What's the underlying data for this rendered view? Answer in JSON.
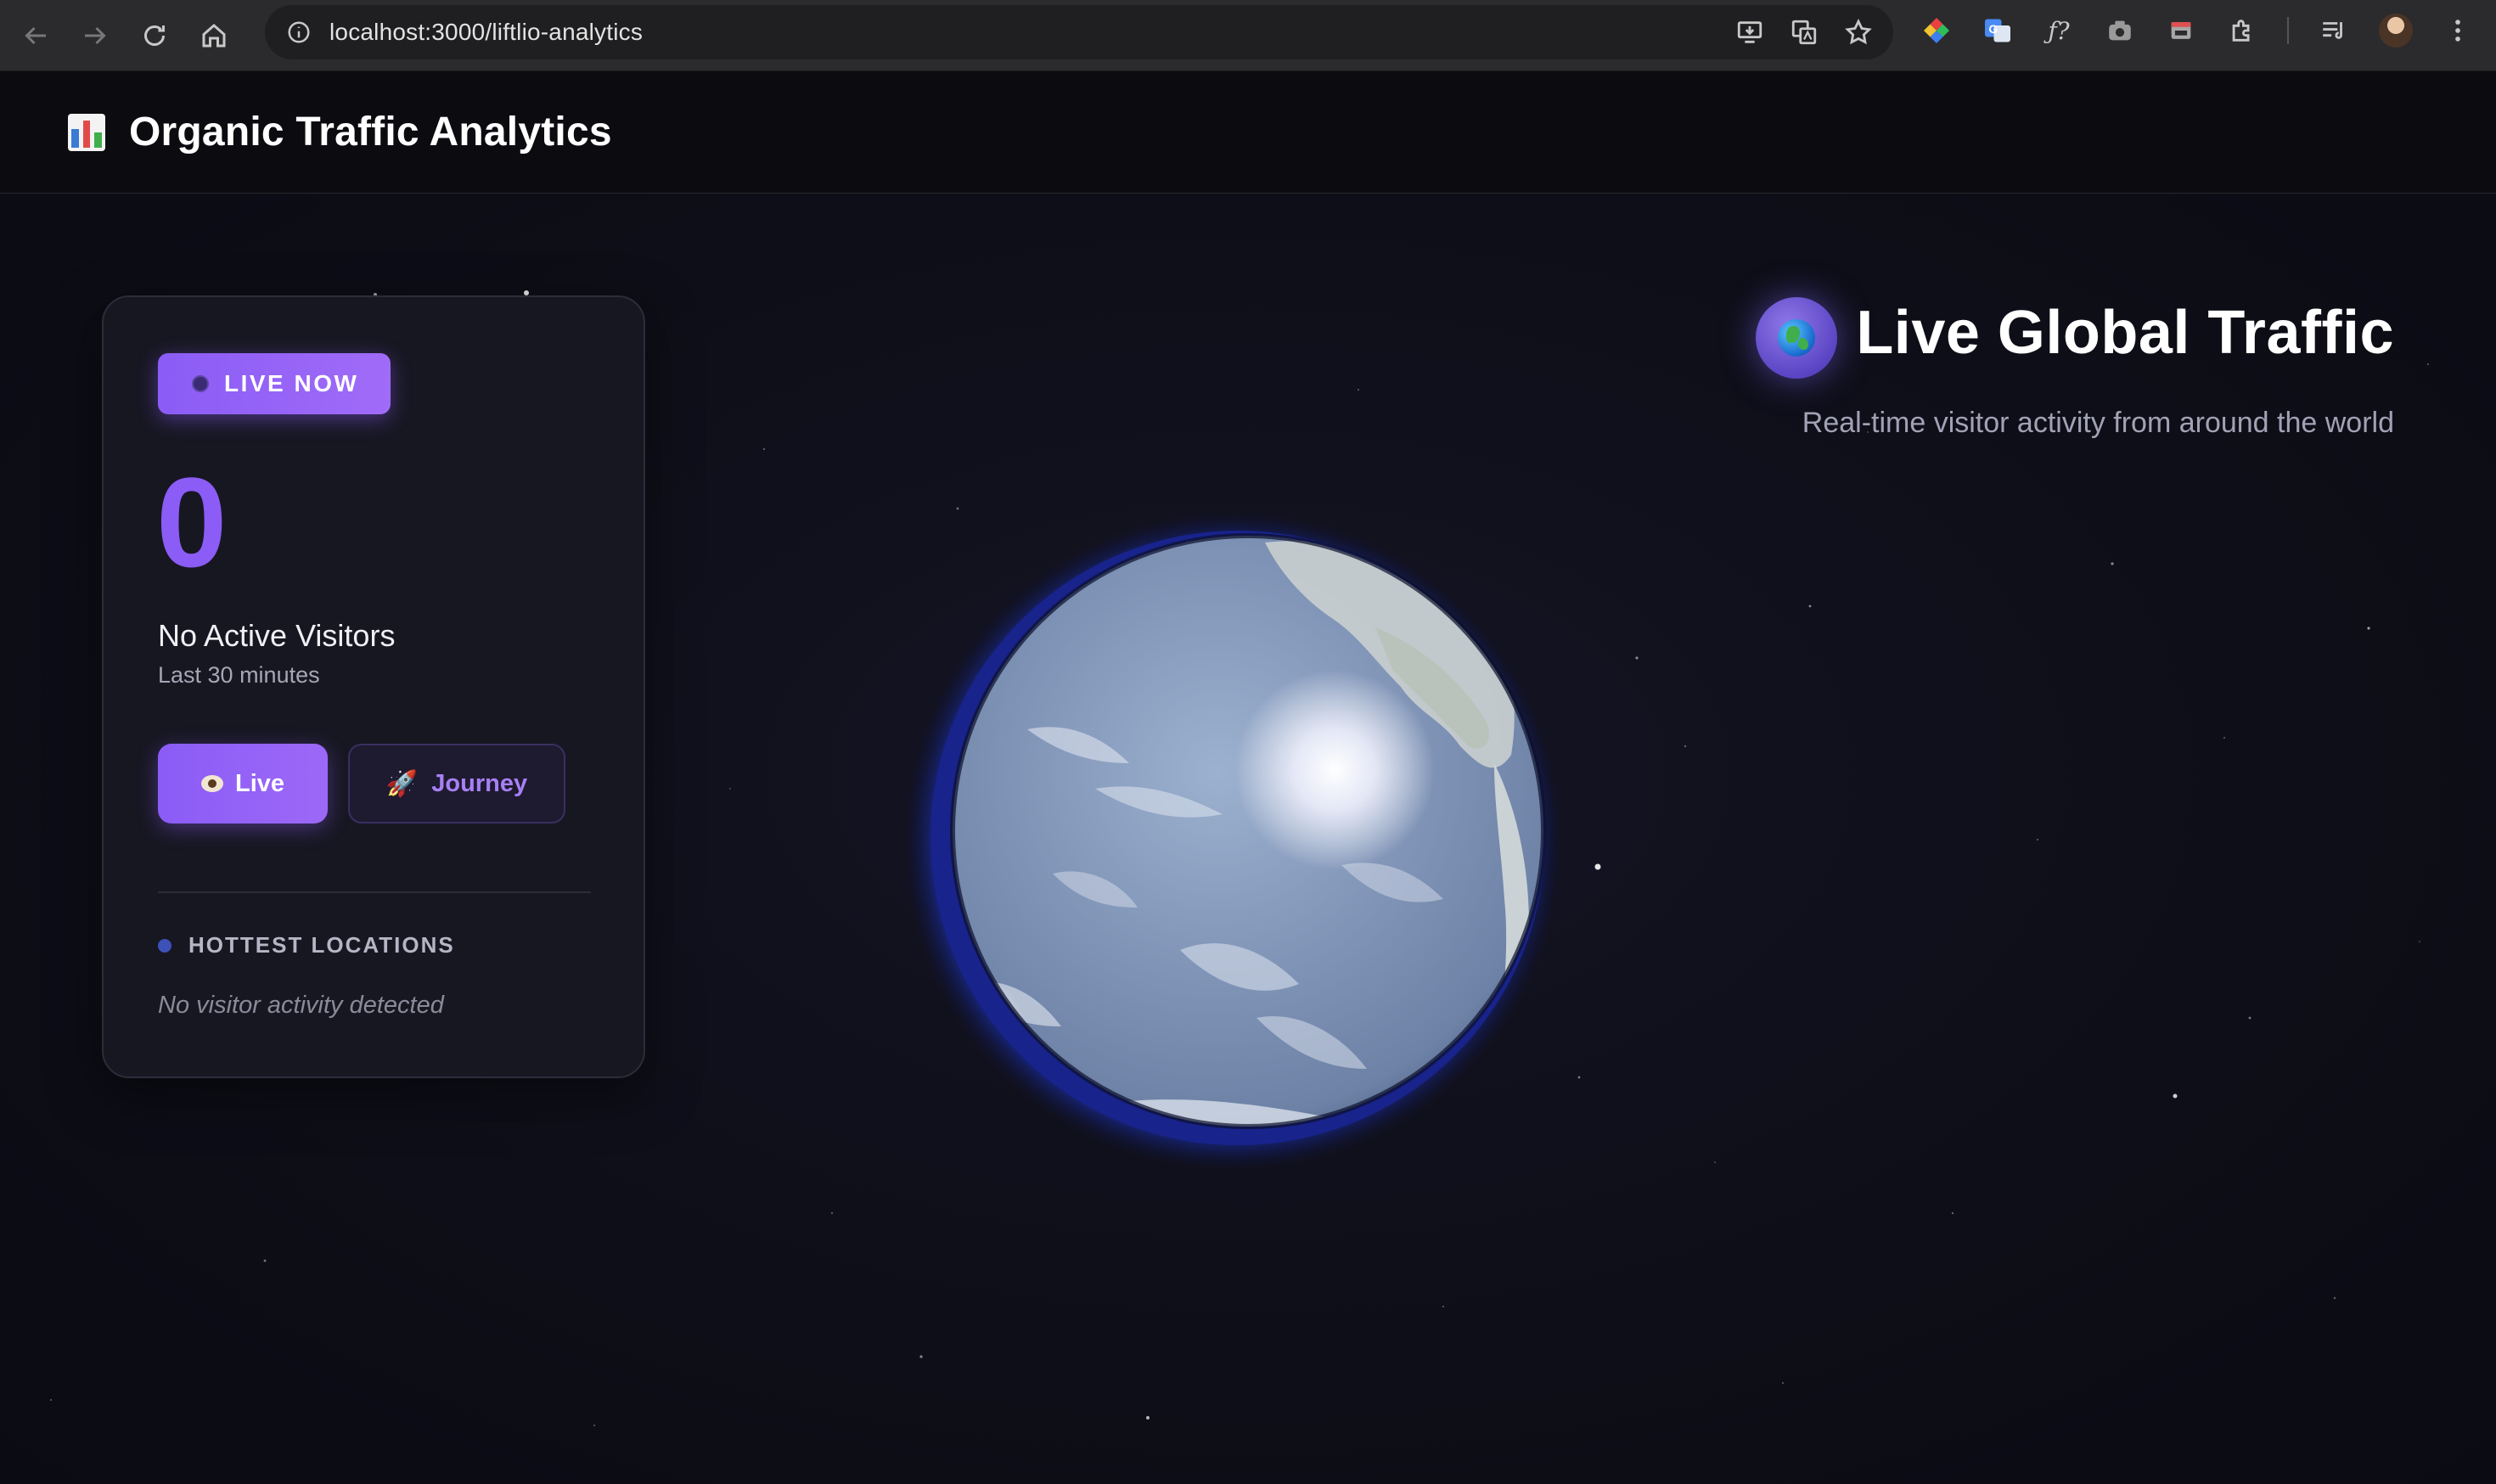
{
  "browser": {
    "url": "localhost:3000/liftlio-analytics",
    "nav_icons": [
      "back-arrow-icon",
      "forward-arrow-icon",
      "reload-icon",
      "home-icon"
    ],
    "omnibox_icons": [
      "install-app-icon",
      "translate-icon",
      "bookmark-star-icon"
    ],
    "extension_icons": [
      "color-picker-extension-icon",
      "google-translate-extension-icon",
      "formula-extension-icon",
      "screenshot-extension-icon",
      "window-extension-icon",
      "extensions-puzzle-icon",
      "reading-list-icon",
      "profile-avatar",
      "more-menu-icon"
    ]
  },
  "header": {
    "title": "Organic Traffic Analytics",
    "icon": "bar-chart-icon"
  },
  "live_card": {
    "badge": "LIVE NOW",
    "count": "0",
    "status": "No Active Visitors",
    "window": "Last 30 minutes",
    "buttons": {
      "live": "Live",
      "journey": "Journey"
    },
    "hottest": {
      "title": "HOTTEST LOCATIONS",
      "empty": "No visitor activity detected"
    }
  },
  "hero": {
    "icon": "globe-icon",
    "title": "Live Global Traffic",
    "subtitle": "Real-time visitor activity from around the world"
  },
  "colors": {
    "accent": "#8b5cf6",
    "background": "#0f0f17",
    "card": "#171722"
  }
}
